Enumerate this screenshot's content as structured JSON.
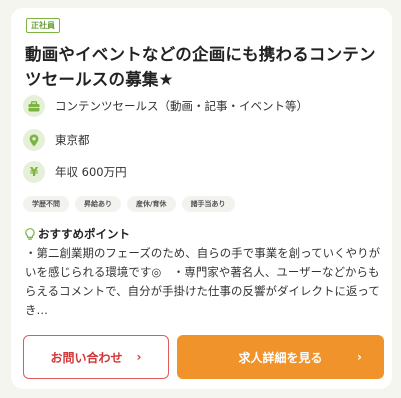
{
  "job": {
    "employment_type": "正社員",
    "title": "動画やイベントなどの企画にも携わるコンテンツセールスの募集★",
    "occupation": "コンテンツセールス（動画・記事・イベント等）",
    "location": "東京都",
    "salary": "年収 600万円",
    "tags": [
      "学歴不問",
      "昇給あり",
      "産休/育休",
      "諸手当あり"
    ],
    "recommend_heading": "おすすめポイント",
    "recommend_text": "・第二創業期のフェーズのため、自らの手で事業を創っていくやりがいを感じられる環境です◎　・専門家や著名人、ユーザーなどからもらえるコメントで、自分が手掛けた仕事の反響がダイレクトに返ってき…",
    "yen_symbol": "¥"
  },
  "buttons": {
    "inquiry_label": "お問い合わせ",
    "detail_label": "求人詳細を見る",
    "chevron": "›"
  },
  "colors": {
    "accent_green": "#7cb342",
    "icon_bg": "#e6f0d9",
    "inquiry_red": "#d03636",
    "detail_orange": "#f0932b",
    "page_bg": "#f3f5ee"
  },
  "icons": {
    "occupation": "briefcase-icon",
    "location": "map-pin-icon",
    "salary": "yen-icon",
    "recommend": "lightbulb-icon"
  }
}
